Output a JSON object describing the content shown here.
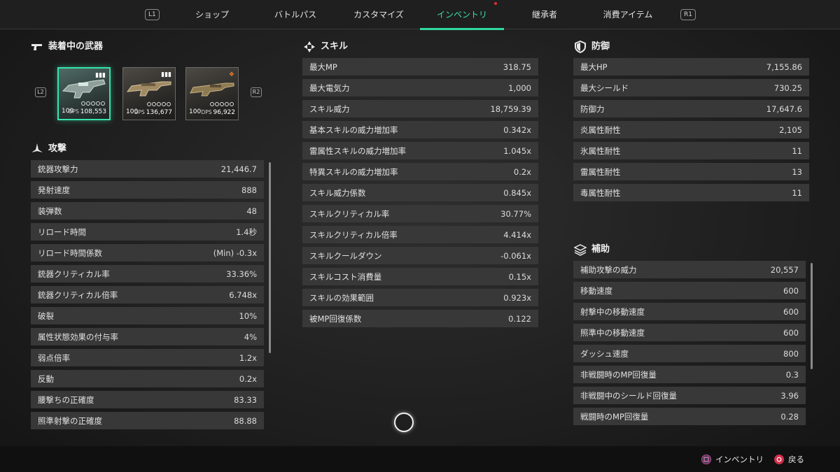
{
  "nav": {
    "left_button": "L1",
    "right_button": "R1",
    "tabs": [
      "ショップ",
      "バトルパス",
      "カスタマイズ",
      "インベントリ",
      "継承者",
      "消費アイテム"
    ],
    "active_tab": "インベントリ"
  },
  "weapons": {
    "title": "装着中の武器",
    "prev_button": "L2",
    "next_button": "R2",
    "items": [
      {
        "level": "100",
        "dps_label": "DPS",
        "dps": "108,553"
      },
      {
        "level": "100",
        "dps_label": "DPS",
        "dps": "136,677"
      },
      {
        "level": "100",
        "dps_label": "DPS",
        "dps": "96,922"
      }
    ]
  },
  "attack": {
    "title": "攻撃",
    "stats": [
      {
        "label": "銃器攻撃力",
        "value": "21,446.7"
      },
      {
        "label": "発射速度",
        "value": "888"
      },
      {
        "label": "装弾数",
        "value": "48"
      },
      {
        "label": "リロード時間",
        "value": "1.4秒"
      },
      {
        "label": "リロード時間係数",
        "value": "(Min) -0.3x"
      },
      {
        "label": "銃器クリティカル率",
        "value": "33.36%"
      },
      {
        "label": "銃器クリティカル倍率",
        "value": "6.748x"
      },
      {
        "label": "破裂",
        "value": "10%"
      },
      {
        "label": "属性状態効果の付与率",
        "value": "4%"
      },
      {
        "label": "弱点倍率",
        "value": "1.2x"
      },
      {
        "label": "反動",
        "value": "0.2x"
      },
      {
        "label": "腰撃ちの正確度",
        "value": "83.33"
      },
      {
        "label": "照準射撃の正確度",
        "value": "88.88"
      }
    ]
  },
  "skill": {
    "title": "スキル",
    "stats": [
      {
        "label": "最大MP",
        "value": "318.75"
      },
      {
        "label": "最大電気力",
        "value": "1,000"
      },
      {
        "label": "スキル威力",
        "value": "18,759.39"
      },
      {
        "label": "基本スキルの威力増加率",
        "value": "0.342x"
      },
      {
        "label": "雷属性スキルの威力増加率",
        "value": "1.045x"
      },
      {
        "label": "特異スキルの威力増加率",
        "value": "0.2x"
      },
      {
        "label": "スキル威力係数",
        "value": "0.845x"
      },
      {
        "label": "スキルクリティカル率",
        "value": "30.77%"
      },
      {
        "label": "スキルクリティカル倍率",
        "value": "4.414x"
      },
      {
        "label": "スキルクールダウン",
        "value": "-0.061x"
      },
      {
        "label": "スキルコスト消費量",
        "value": "0.15x"
      },
      {
        "label": "スキルの効果範囲",
        "value": "0.923x"
      },
      {
        "label": "被MP回復係数",
        "value": "0.122"
      }
    ]
  },
  "defense": {
    "title": "防御",
    "stats": [
      {
        "label": "最大HP",
        "value": "7,155.86"
      },
      {
        "label": "最大シールド",
        "value": "730.25"
      },
      {
        "label": "防御力",
        "value": "17,647.6"
      },
      {
        "label": "炎属性耐性",
        "value": "2,105"
      },
      {
        "label": "氷属性耐性",
        "value": "11"
      },
      {
        "label": "雷属性耐性",
        "value": "13"
      },
      {
        "label": "毒属性耐性",
        "value": "11"
      }
    ]
  },
  "support": {
    "title": "補助",
    "stats": [
      {
        "label": "補助攻撃の威力",
        "value": "20,557"
      },
      {
        "label": "移動速度",
        "value": "600"
      },
      {
        "label": "射撃中の移動速度",
        "value": "600"
      },
      {
        "label": "照準中の移動速度",
        "value": "600"
      },
      {
        "label": "ダッシュ速度",
        "value": "800"
      },
      {
        "label": "非戦闘時のMP回復量",
        "value": "0.3"
      },
      {
        "label": "非戦闘中のシールド回復量",
        "value": "3.96"
      },
      {
        "label": "戦闘時のMP回復量",
        "value": "0.28"
      }
    ]
  },
  "footer": {
    "inventory_label": "インベントリ",
    "back_label": "戻る"
  },
  "colors": {
    "accent": "#37e3ad",
    "row_bg": "#383838",
    "back_button": "#d0304a",
    "square_button": "#c74aa6"
  }
}
